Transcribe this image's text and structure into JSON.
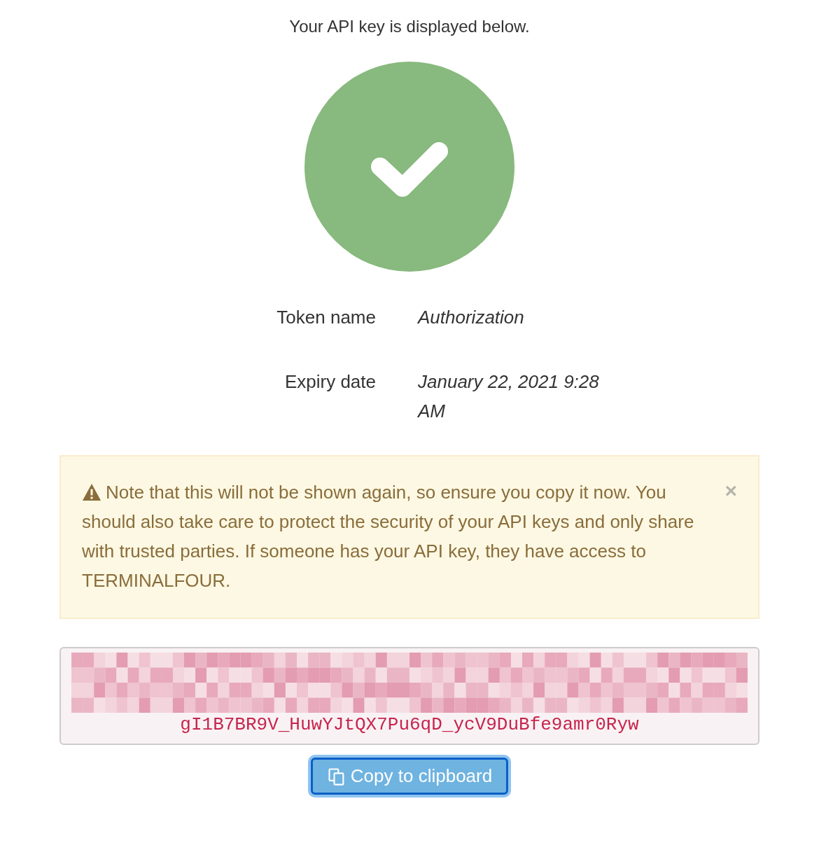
{
  "heading": "Your API key is displayed below.",
  "status": {
    "kind": "success"
  },
  "details": [
    {
      "label": "Token name",
      "value": "Authorization"
    },
    {
      "label": "Expiry date",
      "value": "January 22, 2021 9:28 AM"
    }
  ],
  "alert": {
    "kind": "warning",
    "text": "Note that this will not be shown again, so ensure you copy it now. You should also take care to protect the security of your API keys and only share with trusted parties. If someone has your API key, they have access to TERMINALFOUR.",
    "close": "×"
  },
  "api_key": {
    "redacted": true,
    "visible_line": "gI1B7BR9V_HuwYJtQX7Pu6qD_ycV9DuBfe9amr0Ryw"
  },
  "copy_button": {
    "label": "Copy to clipboard",
    "focused": true
  }
}
